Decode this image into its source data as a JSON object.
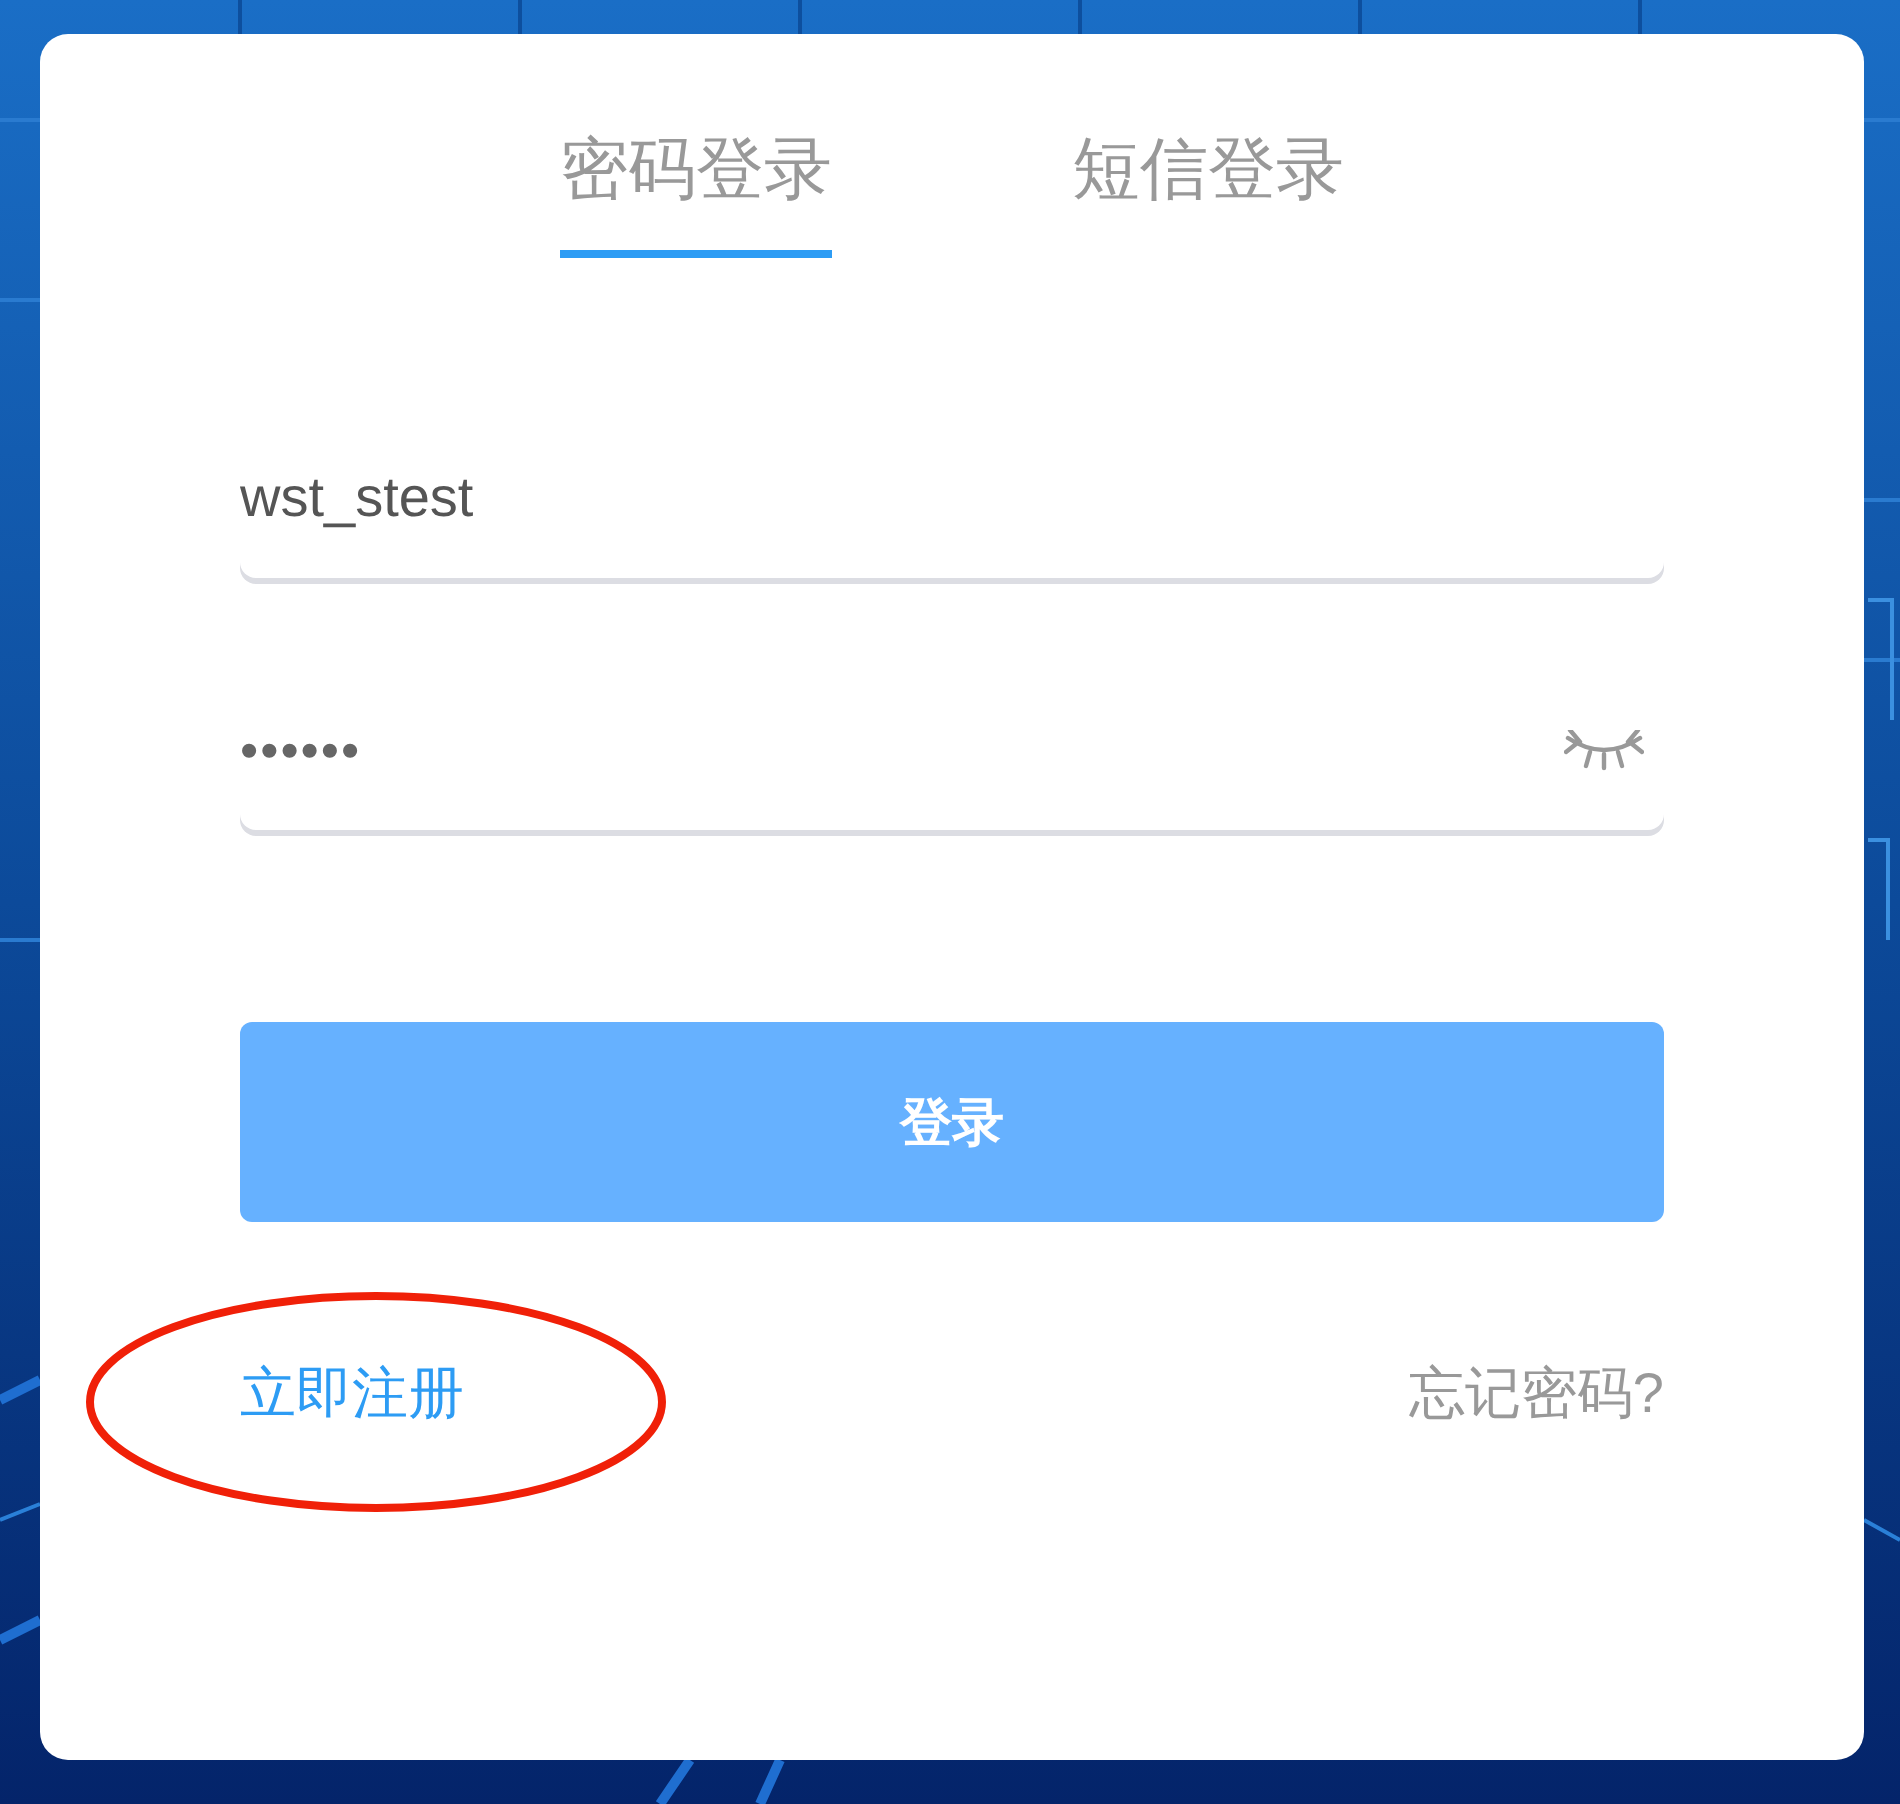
{
  "tabs": [
    {
      "label": "密码登录",
      "selected": true
    },
    {
      "label": "短信登录",
      "selected": false
    }
  ],
  "fields": [
    {
      "kind": "text",
      "value": "wst_stest"
    },
    {
      "kind": "password",
      "value": "••••••"
    }
  ],
  "login_button": "登录",
  "register_link": {
    "label": "立即注册",
    "highlighted": true
  },
  "forgot_link": "忘记密码?"
}
